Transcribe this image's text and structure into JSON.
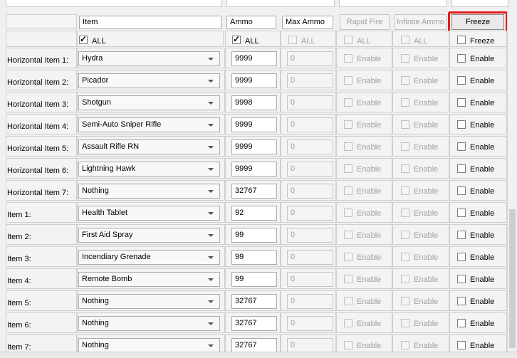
{
  "header": {
    "item_label": "Item",
    "ammo_label": "Ammo",
    "max_ammo_label": "Max Ammo",
    "rapid_fire_button": "Rapid Fire",
    "infinite_ammo_button": "Infinite Ammo",
    "freeze_button": "Freeze",
    "all_label": "ALL",
    "freeze_all_label": "Freeze",
    "highlight_color": "#e51b1b"
  },
  "rows": [
    {
      "label": "Horizontal Item 1:",
      "item": "Hydra",
      "ammo": "9999",
      "max": "0",
      "enable": "Enable",
      "freeze": "Enable"
    },
    {
      "label": "Horizontal Item 2:",
      "item": "Picador",
      "ammo": "9999",
      "max": "0",
      "enable": "Enable",
      "freeze": "Enable"
    },
    {
      "label": "Horizontal Item 3:",
      "item": "Shotgun",
      "ammo": "9998",
      "max": "0",
      "enable": "Enable",
      "freeze": "Enable"
    },
    {
      "label": "Horizontal Item 4:",
      "item": "Semi-Auto Sniper Rifle",
      "ammo": "9999",
      "max": "0",
      "enable": "Enable",
      "freeze": "Enable"
    },
    {
      "label": "Horizontal Item 5:",
      "item": "Assault Rifle RN",
      "ammo": "9999",
      "max": "0",
      "enable": "Enable",
      "freeze": "Enable"
    },
    {
      "label": "Horizontal Item 6:",
      "item": "Lightning Hawk",
      "ammo": "9999",
      "max": "0",
      "enable": "Enable",
      "freeze": "Enable"
    },
    {
      "label": "Horizontal Item 7:",
      "item": "Nothing",
      "ammo": "32767",
      "max": "0",
      "enable": "Enable",
      "freeze": "Enable"
    },
    {
      "label": "Item 1:",
      "item": "Health Tablet",
      "ammo": "92",
      "max": "0",
      "enable": "Enable",
      "freeze": "Enable"
    },
    {
      "label": "Item 2:",
      "item": "First Aid Spray",
      "ammo": "99",
      "max": "0",
      "enable": "Enable",
      "freeze": "Enable"
    },
    {
      "label": "Item 3:",
      "item": "Incendiary Grenade",
      "ammo": "99",
      "max": "0",
      "enable": "Enable",
      "freeze": "Enable"
    },
    {
      "label": "Item 4:",
      "item": "Remote Bomb",
      "ammo": "99",
      "max": "0",
      "enable": "Enable",
      "freeze": "Enable"
    },
    {
      "label": "Item 5:",
      "item": "Nothing",
      "ammo": "32767",
      "max": "0",
      "enable": "Enable",
      "freeze": "Enable"
    },
    {
      "label": "Item 6:",
      "item": "Nothing",
      "ammo": "32767",
      "max": "0",
      "enable": "Enable",
      "freeze": "Enable"
    },
    {
      "label": "Item 7:",
      "item": "Nothing",
      "ammo": "32767",
      "max": "0",
      "enable": "Enable",
      "freeze": "Enable"
    }
  ]
}
